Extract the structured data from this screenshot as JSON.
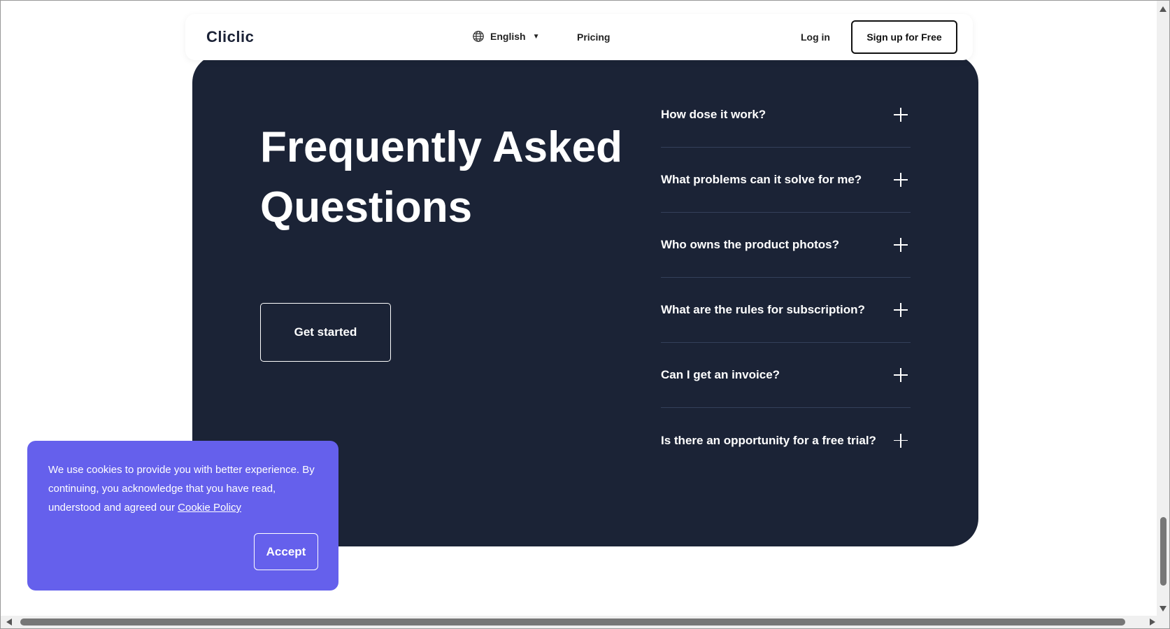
{
  "header": {
    "logo": "Cliclic",
    "language": "English",
    "pricing": "Pricing",
    "login": "Log in",
    "signup": "Sign up for Free"
  },
  "faq": {
    "title": "Frequently Asked Questions",
    "cta": "Get started",
    "items": [
      {
        "question": "How dose it work?"
      },
      {
        "question": "What problems can it solve for me?"
      },
      {
        "question": "Who owns the product photos?"
      },
      {
        "question": "What are the rules for subscription?"
      },
      {
        "question": "Can I get an invoice?"
      },
      {
        "question": "Is there an opportunity for a free trial?"
      }
    ]
  },
  "cookie": {
    "text": "We use cookies to provide you with better experience. By continuing, you acknowledge that you have read, understood and agreed our ",
    "link": "Cookie Policy",
    "accept": "Accept"
  },
  "colors": {
    "panel": "#1b2336",
    "cookie_bg": "#6560ec",
    "text_light": "#ffffff"
  },
  "icons": [
    "globe-icon",
    "caret-down-icon",
    "plus-icon"
  ]
}
